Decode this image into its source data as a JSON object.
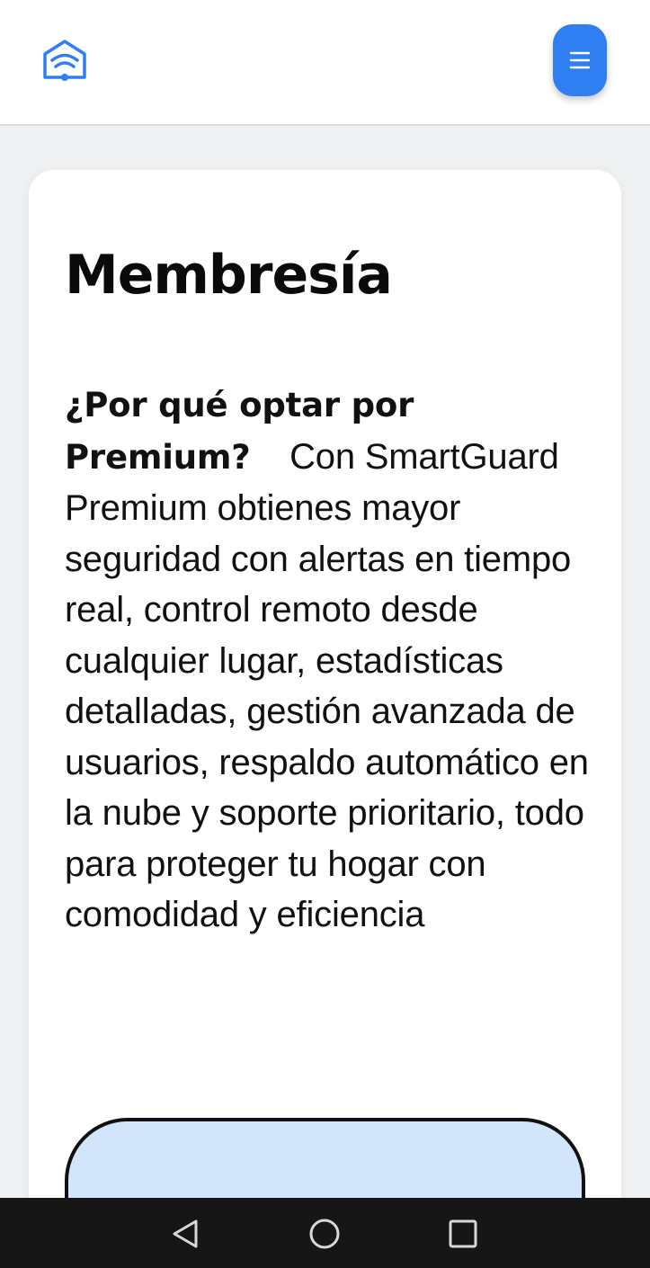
{
  "header": {
    "logo_icon": "wifi-home-icon",
    "menu_icon": "hamburger-menu-icon",
    "accent_color": "#2f7ff3"
  },
  "membership": {
    "title": "Membresía",
    "heading": "¿Por qué optar por Premium?",
    "description": "Con SmartGuard Premium obtienes mayor seguridad con alertas en tiempo real, control remoto desde cualquier lugar, estadísticas detalladas, gestión avanzada de usuarios, respaldo automático en la nube y soporte prioritario, todo para proteger tu hogar con comodidad y eficiencia",
    "plan_box_color": "#d3e5fb"
  },
  "system_nav": {
    "back_icon": "back-triangle-icon",
    "home_icon": "home-circle-icon",
    "recent_icon": "recent-apps-square-icon"
  }
}
